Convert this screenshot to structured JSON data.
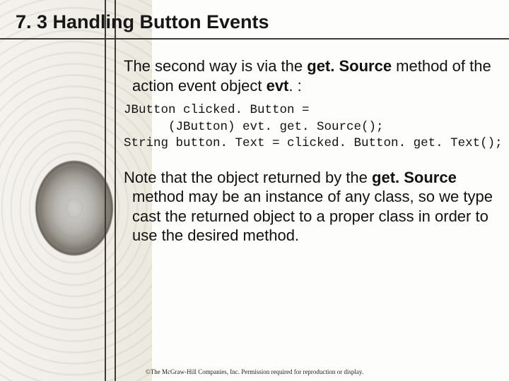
{
  "slide": {
    "title": "7. 3 Handling Button Events",
    "para1_pre": "The second way is via the ",
    "para1_bold1": "get. Source",
    "para1_mid": " method of the action event object ",
    "para1_bold2": "evt",
    "para1_post": ". :",
    "code": "JButton clicked. Button =\n      (JButton) evt. get. Source();\nString button. Text = clicked. Button. get. Text();",
    "para2_pre": "Note that the object returned by the ",
    "para2_bold": "get. Source",
    "para2_post": " method may be an instance of any class, so we type cast the returned object to a proper class in order to use the desired method.",
    "footer": "©The McGraw-Hill Companies, Inc. Permission required for reproduction or display."
  }
}
